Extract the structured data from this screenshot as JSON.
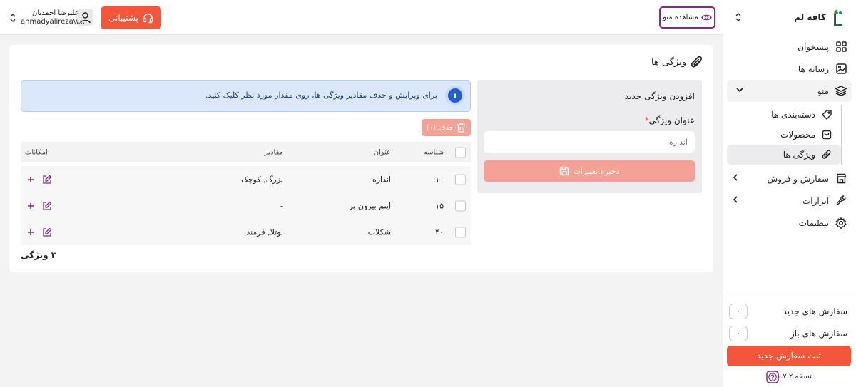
{
  "brand": {
    "name": "کافه لم"
  },
  "sidebar": {
    "items": [
      {
        "label": "پیشخوان",
        "icon": "grid-icon"
      },
      {
        "label": "رسانه ها",
        "icon": "image-icon"
      },
      {
        "label": "منو",
        "icon": "layers-icon"
      },
      {
        "label": "سفارش و فروش",
        "icon": "store-icon"
      },
      {
        "label": "ابزارات",
        "icon": "wrench-icon"
      },
      {
        "label": "تنظیمات",
        "icon": "gear-icon"
      }
    ],
    "submenu": [
      {
        "label": "دسته‌بندی ها",
        "icon": "tag-icon"
      },
      {
        "label": "محصولات",
        "icon": "box-icon"
      },
      {
        "label": "ویژگی ها",
        "icon": "paperclip-icon"
      }
    ],
    "new_orders_label": "سفارش های جدید",
    "new_orders_count": "۰",
    "open_orders_label": "سفارش های باز",
    "open_orders_count": "۰",
    "new_order_button": "ثبت سفارش جدید",
    "version": "نسخه ۱.۷.۲"
  },
  "topbar": {
    "view_menu": "مشاهده منو",
    "support": "پشتیبانی",
    "user_name": "علیرضا احمدیان",
    "user_email": "ahmadyalireza\\\\..."
  },
  "page": {
    "title": "ویژگی ها",
    "add_title": "افزودن ویژگی جدید",
    "field_label": "عنوان ویژگی",
    "field_placeholder": "اندازه",
    "save_label": "ذخیره تغییرات",
    "info_text": "برای ویرایش و حذف مقادیر ویژگی ها، روی مقدار مورد نظر کلیک کنید.",
    "delete_label": "حذف (۰)",
    "count_label": "۳ ویژگی"
  },
  "table": {
    "headers": {
      "id": "شناسه",
      "title": "عنوان",
      "values": "مقادیر",
      "actions": "امکانات"
    },
    "rows": [
      {
        "id": "۱۰",
        "title": "اندازه",
        "values": "بزرگ, کوچک"
      },
      {
        "id": "۱۵",
        "title": "ایتم بیرون بر",
        "values": "-"
      },
      {
        "id": "۴۰",
        "title": "شکلات",
        "values": "نوتلا, فرمند"
      }
    ]
  },
  "colors": {
    "accent": "#f4563c",
    "accent_light": "#f4a295",
    "brand_purple": "#7b2f7e",
    "info_blue": "#1f5fd1"
  }
}
